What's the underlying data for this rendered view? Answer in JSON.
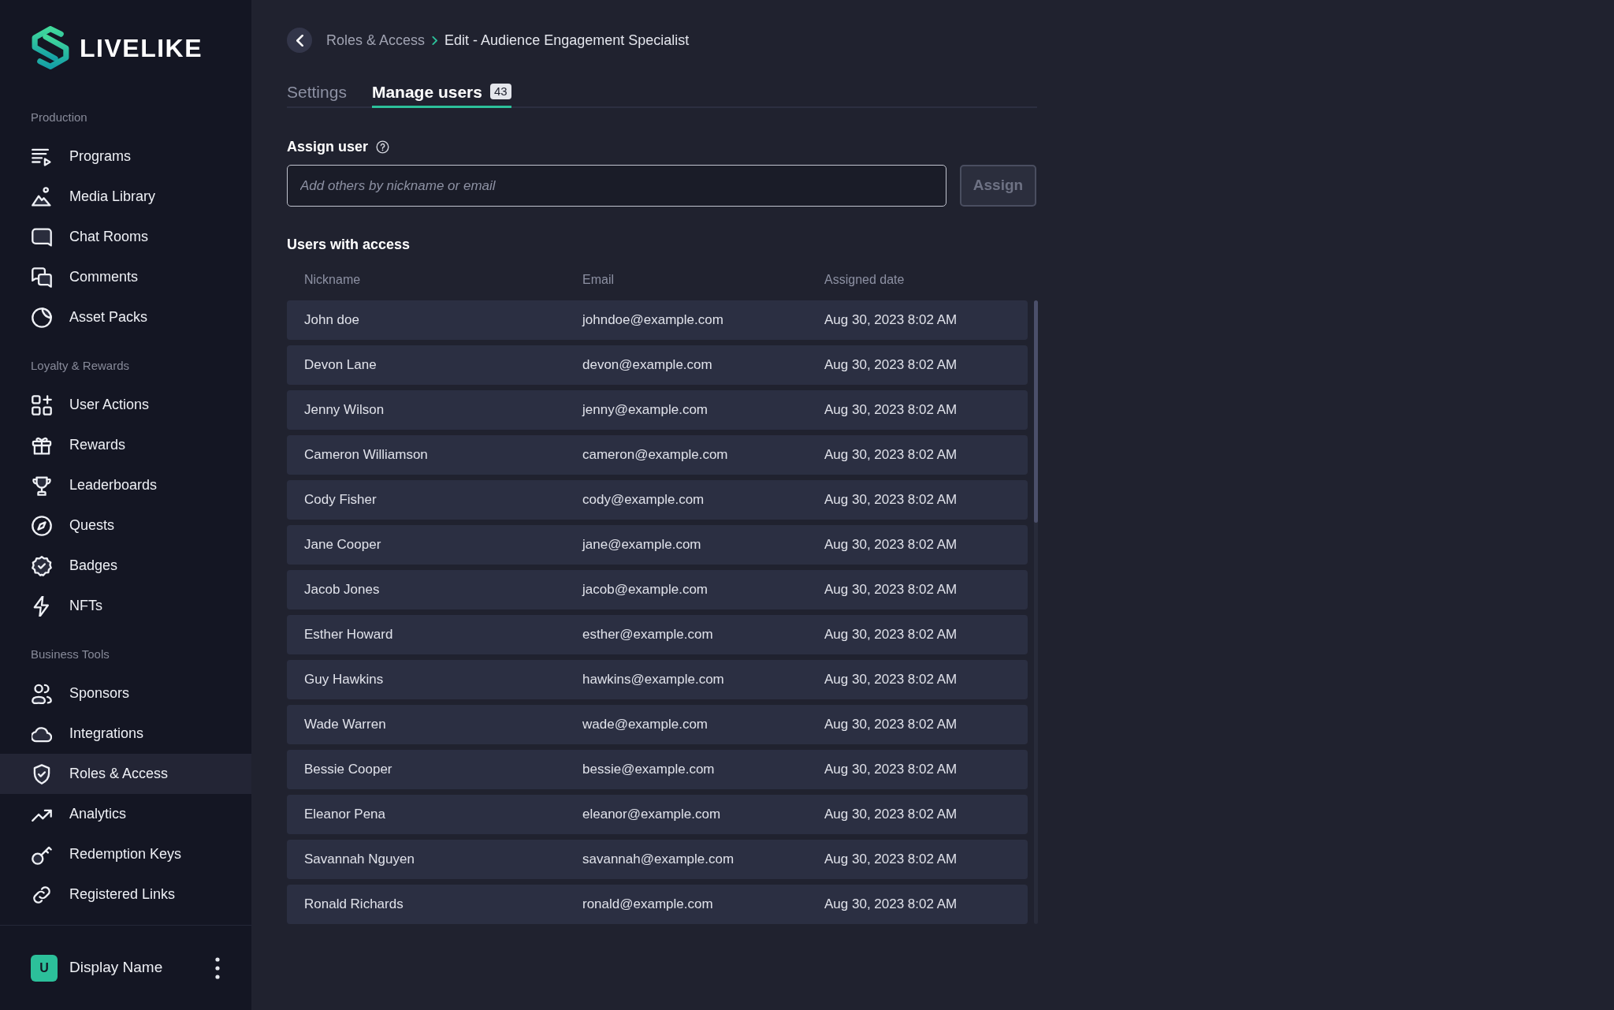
{
  "sidebar": {
    "logo_text": "LIVELIKE",
    "sections": [
      {
        "title": "Production",
        "items": [
          {
            "label": "Programs",
            "selected": false
          },
          {
            "label": "Media Library",
            "selected": false
          },
          {
            "label": "Chat Rooms",
            "selected": false
          },
          {
            "label": "Comments",
            "selected": false
          },
          {
            "label": "Asset Packs",
            "selected": false
          }
        ]
      },
      {
        "title": "Loyalty & Rewards",
        "items": [
          {
            "label": "User Actions",
            "selected": false
          },
          {
            "label": "Rewards",
            "selected": false
          },
          {
            "label": "Leaderboards",
            "selected": false
          },
          {
            "label": "Quests",
            "selected": false
          },
          {
            "label": "Badges",
            "selected": false
          },
          {
            "label": "NFTs",
            "selected": false
          }
        ]
      },
      {
        "title": "Business Tools",
        "items": [
          {
            "label": "Sponsors",
            "selected": false
          },
          {
            "label": "Integrations",
            "selected": false
          },
          {
            "label": "Roles & Access",
            "selected": true
          },
          {
            "label": "Analytics",
            "selected": false
          },
          {
            "label": "Redemption Keys",
            "selected": false
          },
          {
            "label": "Registered Links",
            "selected": false
          }
        ]
      }
    ],
    "user": {
      "initial": "U",
      "display_name": "Display Name"
    }
  },
  "breadcrumb": [
    "Roles & Access",
    "Edit - Audience Engagement Specialist"
  ],
  "tabs": [
    {
      "label": "Settings",
      "selected": false
    },
    {
      "label": "Manage users",
      "selected": true,
      "badge": "43"
    }
  ],
  "assign_user": {
    "label": "Assign user",
    "placeholder": "Add others by nickname or email",
    "button": {
      "label": "Assign",
      "disabled": true
    }
  },
  "users_table": {
    "title": "Users with access",
    "columns": [
      "Nickname",
      "Email",
      "Assigned date"
    ],
    "rows": [
      {
        "nickname": "John doe",
        "email": "johndoe@example.com",
        "assigned_date": "Aug 30, 2023 8:02 AM"
      },
      {
        "nickname": "Devon Lane",
        "email": "devon@example.com",
        "assigned_date": "Aug 30, 2023 8:02 AM"
      },
      {
        "nickname": "Jenny Wilson",
        "email": "jenny@example.com",
        "assigned_date": "Aug 30, 2023 8:02 AM"
      },
      {
        "nickname": "Cameron Williamson",
        "email": "cameron@example.com",
        "assigned_date": "Aug 30, 2023 8:02 AM"
      },
      {
        "nickname": "Cody Fisher",
        "email": "cody@example.com",
        "assigned_date": "Aug 30, 2023 8:02 AM"
      },
      {
        "nickname": "Jane Cooper",
        "email": "jane@example.com",
        "assigned_date": "Aug 30, 2023 8:02 AM"
      },
      {
        "nickname": "Jacob Jones",
        "email": "jacob@example.com",
        "assigned_date": "Aug 30, 2023 8:02 AM"
      },
      {
        "nickname": "Esther Howard",
        "email": "esther@example.com",
        "assigned_date": "Aug 30, 2023 8:02 AM"
      },
      {
        "nickname": "Guy Hawkins",
        "email": "hawkins@example.com",
        "assigned_date": "Aug 30, 2023 8:02 AM"
      },
      {
        "nickname": "Wade Warren",
        "email": "wade@example.com",
        "assigned_date": "Aug 30, 2023 8:02 AM"
      },
      {
        "nickname": "Bessie Cooper",
        "email": "bessie@example.com",
        "assigned_date": "Aug 30, 2023 8:02 AM"
      },
      {
        "nickname": "Eleanor Pena",
        "email": "eleanor@example.com",
        "assigned_date": "Aug 30, 2023 8:02 AM"
      },
      {
        "nickname": "Savannah Nguyen",
        "email": "savannah@example.com",
        "assigned_date": "Aug 30, 2023 8:02 AM"
      },
      {
        "nickname": "Ronald Richards",
        "email": "ronald@example.com",
        "assigned_date": "Aug 30, 2023 8:02 AM"
      }
    ]
  }
}
